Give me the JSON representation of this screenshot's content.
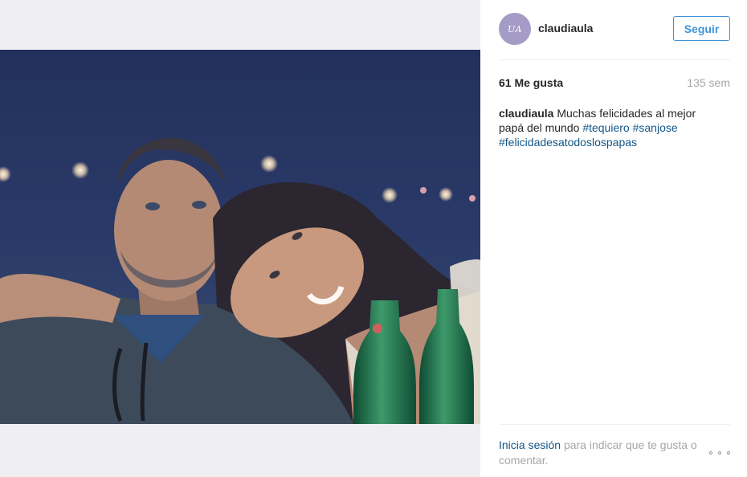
{
  "post": {
    "username": "claudiaula",
    "avatar_initials": "UA",
    "follow_label": "Seguir",
    "likes": "61 Me gusta",
    "age": "135 sem",
    "caption": {
      "user": "claudiaula",
      "text": "Muchas felicidades al mejor papá del mundo",
      "hashtags": [
        "#tequiero",
        "#sanjose",
        "#felicidadesatodoslospapas"
      ]
    }
  },
  "footer": {
    "login_link": "Inicia sesión",
    "prompt": "para indicar que te gusta o comentar."
  },
  "colors": {
    "accent": "#3f92d8",
    "link": "#125688",
    "muted": "#a5a7aa",
    "avatar": "#a49bc6"
  }
}
